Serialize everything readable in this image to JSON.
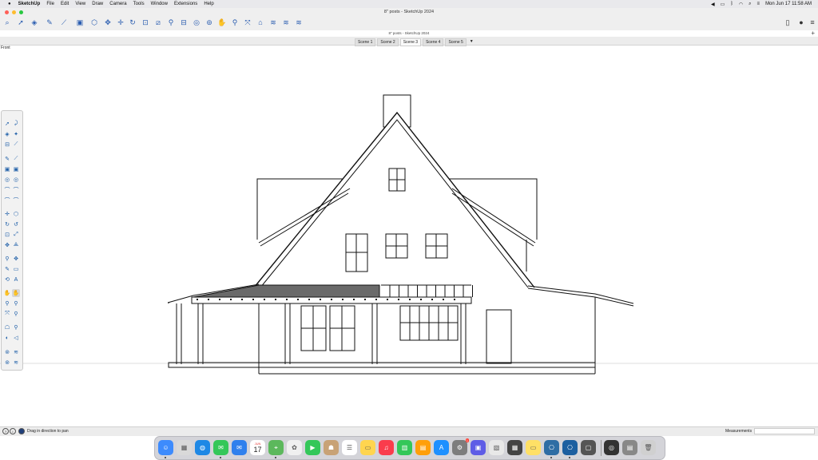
{
  "menubar": {
    "app_name": "SketchUp",
    "items": [
      "File",
      "Edit",
      "View",
      "Draw",
      "Camera",
      "Tools",
      "Window",
      "Extensions",
      "Help"
    ],
    "clock": "Mon Jun 17  11:58 AM"
  },
  "window": {
    "title": "8\" posts - SketchUp 2024",
    "subtitle": "8\" posts - SketchUp 2024"
  },
  "toolbar": {
    "tools": [
      "search-icon",
      "select-icon",
      "eraser-icon",
      "paint-icon",
      "line-icon",
      "rectangle-icon",
      "push-pull-icon",
      "move-icon",
      "rotate-icon",
      "scale-icon",
      "offset-icon",
      "tape-measure-icon",
      "dimension-icon",
      "protractor-icon",
      "text-icon",
      "orbit-icon",
      "pan-icon",
      "zoom-icon",
      "zoom-extents-icon",
      "warehouse-icon",
      "extension-warehouse-icon",
      "layout-icon",
      "send-to-layout-icon"
    ],
    "right_tools": [
      "document-icon",
      "user-icon",
      "sidebar-icon"
    ]
  },
  "scenes": {
    "tabs": [
      "Scene 1",
      "Scene 2",
      "Scene 3",
      "Scene 4",
      "Scene 5"
    ],
    "active": "Scene 3",
    "menu_label": "▼"
  },
  "viewport": {
    "view_name": "Front"
  },
  "status": {
    "hint": "Drag in direction to pan",
    "measurements_label": "Measurements",
    "measurements_value": ""
  },
  "dock": {
    "apps": [
      "Finder",
      "Launchpad",
      "Safari",
      "Messages",
      "Mail",
      "Calendar",
      "Maps",
      "Photos",
      "FaceTime",
      "Contacts",
      "Reminders",
      "Notes",
      "Music",
      "Numbers",
      "Keynote",
      "App Store",
      "System Settings",
      "Screens",
      "Preview",
      "Calculator",
      "Stickies",
      "SketchUp",
      "SketchUp Viewer",
      "Screenshot",
      "QuickTime Player",
      "Image Capture",
      "Trash"
    ],
    "calendar_day": "17",
    "calendar_month": "JUN",
    "badge": "1"
  },
  "colors": {
    "accent": "#2a5db0",
    "canvas": "#ffffff",
    "roof_fill": "#6a6a6a"
  }
}
